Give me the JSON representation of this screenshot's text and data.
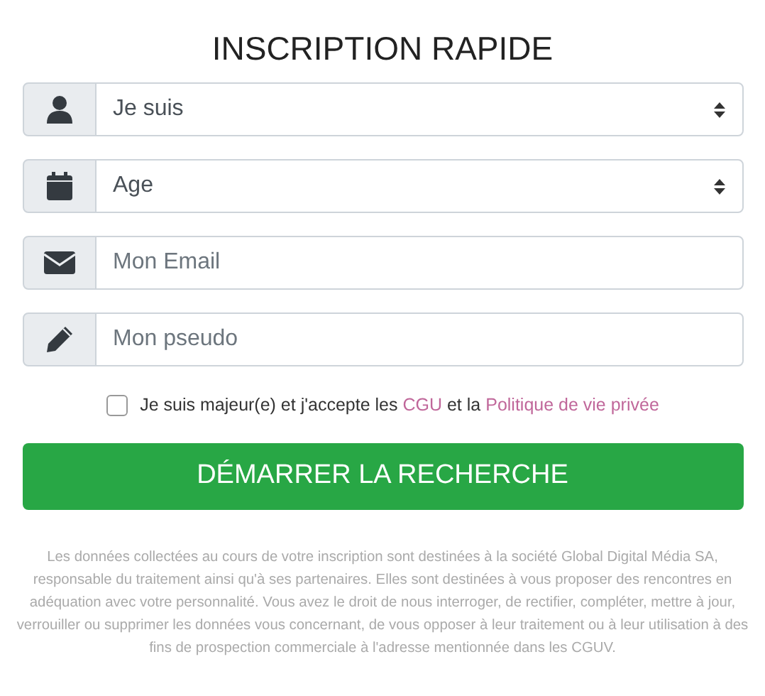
{
  "title": "INSCRIPTION RAPIDE",
  "fields": [
    {
      "kind": "select",
      "value": "Je suis"
    },
    {
      "kind": "select",
      "value": "Age"
    },
    {
      "kind": "input",
      "placeholder": "Mon Email"
    },
    {
      "kind": "input",
      "placeholder": "Mon pseudo"
    }
  ],
  "consent": {
    "checked": false,
    "parts": [
      {
        "kind": "text",
        "text": "Je suis majeur(e) et j'accepte les"
      },
      {
        "kind": "link",
        "text": "CGU"
      },
      {
        "kind": "text",
        "text": "et la"
      },
      {
        "kind": "link",
        "text": "Politique de vie privée"
      }
    ]
  },
  "submit": "DÉMARRER LA RECHERCHE",
  "disclaimer": "Les données collectées au cours de votre inscription sont destinées à la société Global Digital Média SA, responsable du traitement ainsi qu'à ses partenaires. Elles sont destinées à vous proposer des rencontres en adéquation avec votre personnalité. Vous avez le droit de nous interroger, de rectifier, compléter, mettre à jour, verrouiller ou supprimer les données vous concernant, de vous opposer à leur traitement ou à leur utilisation à des fins de prospection commerciale à l'adresse mentionnée dans les CGUV."
}
